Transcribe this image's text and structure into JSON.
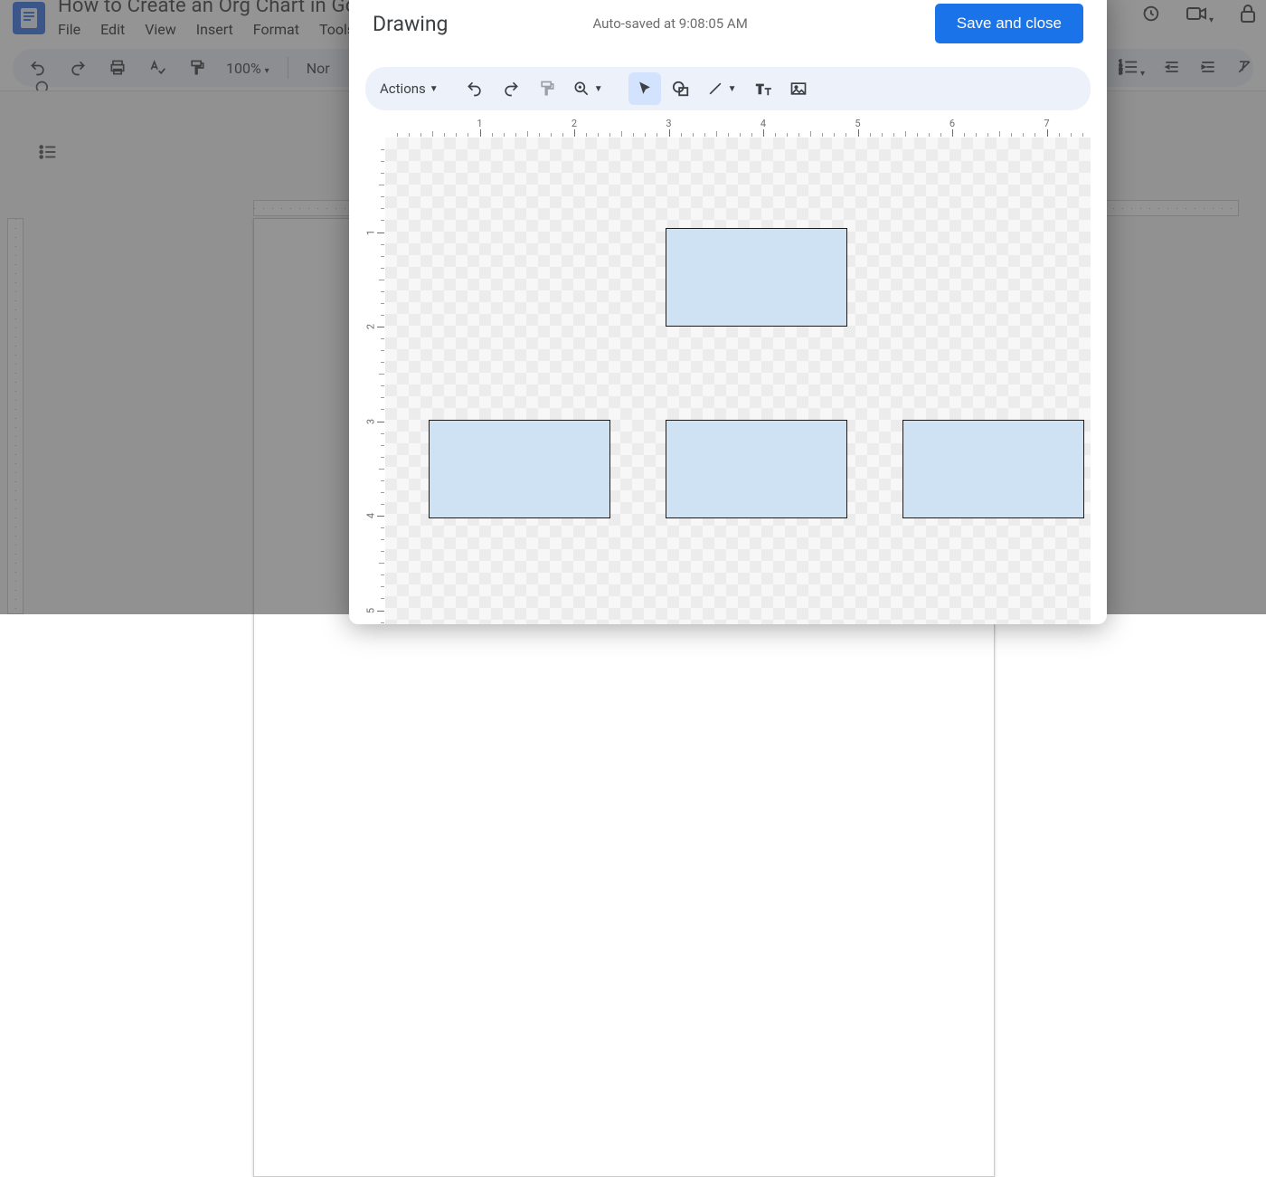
{
  "docs": {
    "title_truncated": "How to Create an Org Chart in Go",
    "menus": [
      "File",
      "Edit",
      "View",
      "Insert",
      "Format",
      "Tools"
    ],
    "zoom_label": "100%",
    "style_label_truncated": "Nor"
  },
  "dialog": {
    "title": "Drawing",
    "autosave": "Auto-saved at 9:08:05 AM",
    "save_label": "Save and close",
    "actions_label": "Actions",
    "shapes": [
      {
        "kind": "rectangle",
        "fill": "#cfe2f3",
        "stroke": "#000000"
      },
      {
        "kind": "rectangle",
        "fill": "#cfe2f3",
        "stroke": "#000000"
      },
      {
        "kind": "rectangle",
        "fill": "#cfe2f3",
        "stroke": "#000000"
      },
      {
        "kind": "rectangle",
        "fill": "#cfe2f3",
        "stroke": "#000000"
      }
    ],
    "ruler_h_labels": [
      "1",
      "2",
      "3",
      "4",
      "5",
      "6",
      "7"
    ],
    "ruler_v_labels": [
      "1",
      "2",
      "3",
      "4",
      "5"
    ]
  },
  "icons": {
    "docs_logo": "docs-logo",
    "undo": "undo-icon",
    "redo": "redo-icon",
    "print": "print-icon",
    "spellcheck": "spellcheck-icon",
    "paint": "format-paint-icon",
    "search": "search-icon",
    "outline": "bulleted-list-icon",
    "lock": "lock-icon",
    "video": "video-icon",
    "clock": "history-icon",
    "bulleted": "bulleted-list-icon",
    "indent_dec": "decrease-indent-icon",
    "indent_inc": "increase-indent-icon",
    "clear_fmt": "clear-formatting-icon",
    "zoom": "zoom-icon",
    "select": "select-icon",
    "shape": "shape-icon",
    "line": "line-icon",
    "text": "textbox-icon",
    "image": "image-icon"
  }
}
